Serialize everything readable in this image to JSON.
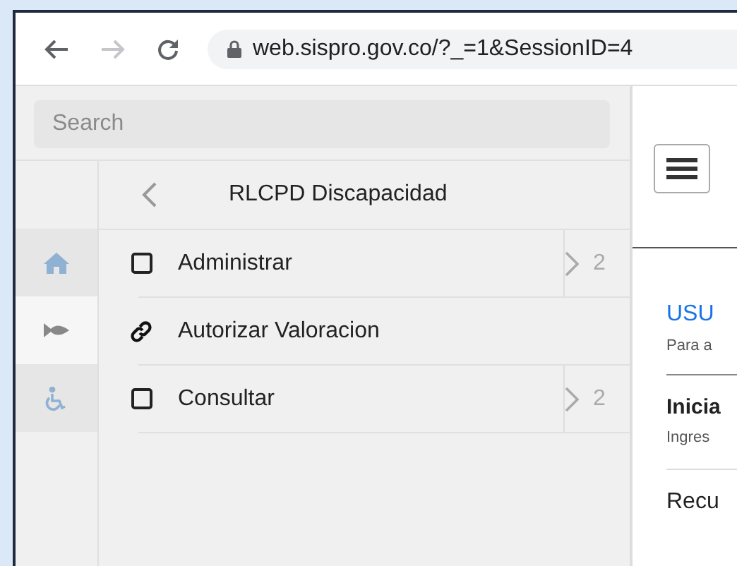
{
  "browser": {
    "forward_disabled": true,
    "address": "web.sispro.gov.co/?_=1&SessionID=4"
  },
  "sidebar": {
    "search": {
      "placeholder": "Search"
    },
    "rail": [
      {
        "kind": "home",
        "selected": false
      },
      {
        "kind": "fish",
        "selected": true
      },
      {
        "kind": "wheelchair",
        "selected": false
      }
    ]
  },
  "menu": {
    "title": "RLCPD Discapacidad",
    "items": [
      {
        "kind": "folder",
        "label": "Administrar",
        "count": "2"
      },
      {
        "kind": "link",
        "label": "Autorizar Valoracion"
      },
      {
        "kind": "folder",
        "label": "Consultar",
        "count": "2"
      }
    ]
  },
  "main": {
    "user_heading": "USU",
    "user_note": "Para a",
    "login_heading": "Inicia",
    "login_note": "Ingres",
    "recover": "Recu"
  }
}
